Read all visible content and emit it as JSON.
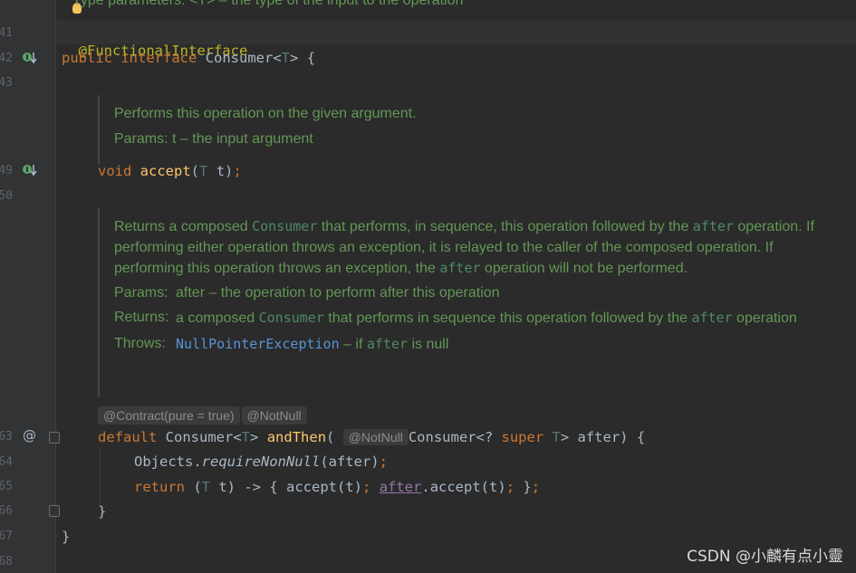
{
  "gutter": {
    "line_numbers": [
      "41",
      "42",
      "43",
      "49",
      "50",
      "63",
      "64",
      "65",
      "66",
      "67",
      "68"
    ],
    "icons": [
      "implemented-down-icon",
      "implemented-down-icon",
      "at-icon"
    ]
  },
  "top_doc": {
    "text": "Type parameters: <T> – the type of the input to the operation"
  },
  "code": {
    "line41_annotation": "@FunctionalInterface",
    "line42": {
      "kw1": "public",
      "kw2": "interface",
      "name": "Consumer<",
      "tp": "T",
      "rest": "> {"
    },
    "line49": {
      "kw": "void",
      "fn": "accept",
      "open": "(",
      "tp": "T",
      "rest": " t)",
      "semi": ";"
    },
    "line63": {
      "kw": "default",
      "type": "Consumer<",
      "tp": "T",
      "close": ">",
      "fn": "andThen",
      "open": "(",
      "type2": "Consumer<? ",
      "super": "super",
      "tp2": "T",
      "rest": "> after) {"
    },
    "line64": {
      "obj": "Objects.",
      "method": "requireNonNull",
      "rest": "(after)",
      "semi": ";"
    },
    "line65": {
      "kw": "return",
      "open": " (",
      "tp": "T",
      "mid": " t) -> { accept(t)",
      "semi1": ";",
      "after": "after",
      "rest": ".accept(t)",
      "semi2": ";",
      "end": " }",
      "semi3": ";"
    },
    "line66": "}",
    "line67": "}"
  },
  "doc_accept": {
    "desc": "Performs this operation on the given argument.",
    "params_label": "Params:",
    "params_value": " t – the input argument"
  },
  "doc_andthen": {
    "p1a": "Returns a composed ",
    "c1": "Consumer",
    "p1b": " that performs, in sequence, this operation followed by the ",
    "c2": "after",
    "p1c": " operation. If performing either operation throws an exception, it is relayed to the caller of the composed operation. If performing this operation throws an exception, the ",
    "c3": "after",
    "p1d": " operation will not be performed.",
    "params_label": "Params:",
    "params_value": "after – the operation to perform after this operation",
    "returns_label": "Returns:",
    "returns_a": "a composed ",
    "returns_c": "Consumer",
    "returns_b": " that performs in sequence this operation followed by the ",
    "returns_c2": "after",
    "returns_d": " operation",
    "throws_label": "Throws:",
    "throws_link": "NullPointerException",
    "throws_a": " – if ",
    "throws_c": "after",
    "throws_b": " is null"
  },
  "inlays": {
    "contract": "@Contract(pure = true)",
    "notnull1": "@NotNull",
    "notnull2": "@NotNull"
  },
  "watermark": "CSDN @小麟有点小靈"
}
